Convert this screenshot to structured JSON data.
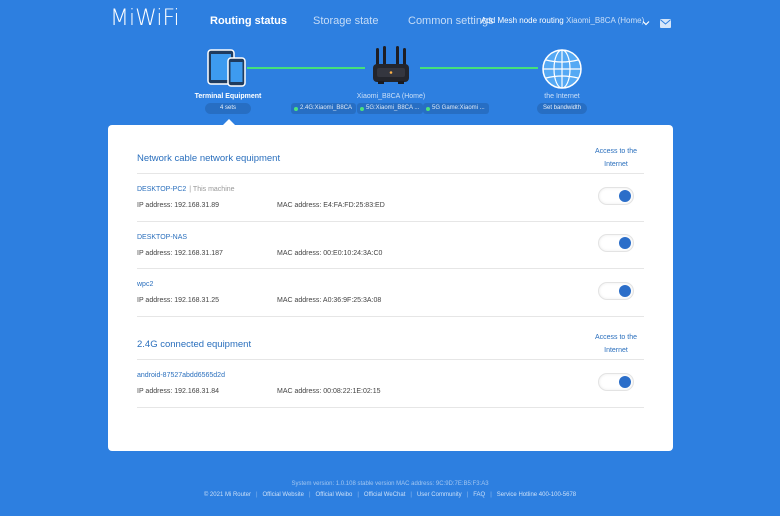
{
  "header": {
    "logo": "MiWiFi",
    "tabs": [
      {
        "label": "Routing status",
        "active": true
      },
      {
        "label": "Storage state",
        "active": false
      },
      {
        "label": "Common settings",
        "active": false
      }
    ],
    "mesh_link": "Add Mesh node routing",
    "router_selector": "Xiaomi_B8CA (Home)"
  },
  "topology": {
    "terminal": {
      "label": "Terminal Equipment",
      "count": "4 sets"
    },
    "router": {
      "name": "Xiaomi_B8CA (Home)",
      "ssids": [
        "2.4G:Xiaomi_B8CA",
        "5G:Xiaomi_B8CA ...",
        "5G Game:Xiaomi ..."
      ]
    },
    "internet": {
      "label": "the Internet",
      "action": "Set bandwidth"
    }
  },
  "sections": {
    "wired": {
      "title": "Network cable network equipment",
      "access_header_line1": "Access to the",
      "access_header_line2": "Internet",
      "devices": [
        {
          "name": "DESKTOP-PC2",
          "tag": "| This machine",
          "ip": "IP address: 192.168.31.89",
          "mac": "MAC address: E4:FA:FD:25:83:ED",
          "access": true
        },
        {
          "name": "DESKTOP-NAS",
          "tag": "",
          "ip": "IP address: 192.168.31.187",
          "mac": "MAC address: 00:E0:10:24:3A:C0",
          "access": true
        },
        {
          "name": "wpc2",
          "tag": "",
          "ip": "IP address: 192.168.31.25",
          "mac": "MAC address: A0:36:9F:25:3A:08",
          "access": true
        }
      ]
    },
    "wifi24": {
      "title": "2.4G connected equipment",
      "access_header_line1": "Access to the",
      "access_header_line2": "Internet",
      "devices": [
        {
          "name": "android-87527abdd6565d2d",
          "tag": "",
          "ip": "IP address: 192.168.31.84",
          "mac": "MAC address: 00:08:22:1E:02:15",
          "access": true
        }
      ]
    }
  },
  "footer": {
    "system_version": "System version: 1.0.108 stable version MAC address: 9C:9D:7E:B5:F3:A3",
    "links": [
      "© 2021 Mi Router",
      "Official Website",
      "Official Weibo",
      "Official WeChat",
      "User Community",
      "FAQ",
      "Service Hotline 400-100-5678"
    ]
  },
  "colors": {
    "background": "#2d7fe0",
    "link_connection": "#45e07a",
    "accent_text": "#2a6fbd",
    "toggle_on": "#2b6ec9"
  },
  "icons": [
    "tablet-phone-icon",
    "router-icon",
    "globe-icon",
    "chevron-down-icon",
    "mail-icon"
  ]
}
